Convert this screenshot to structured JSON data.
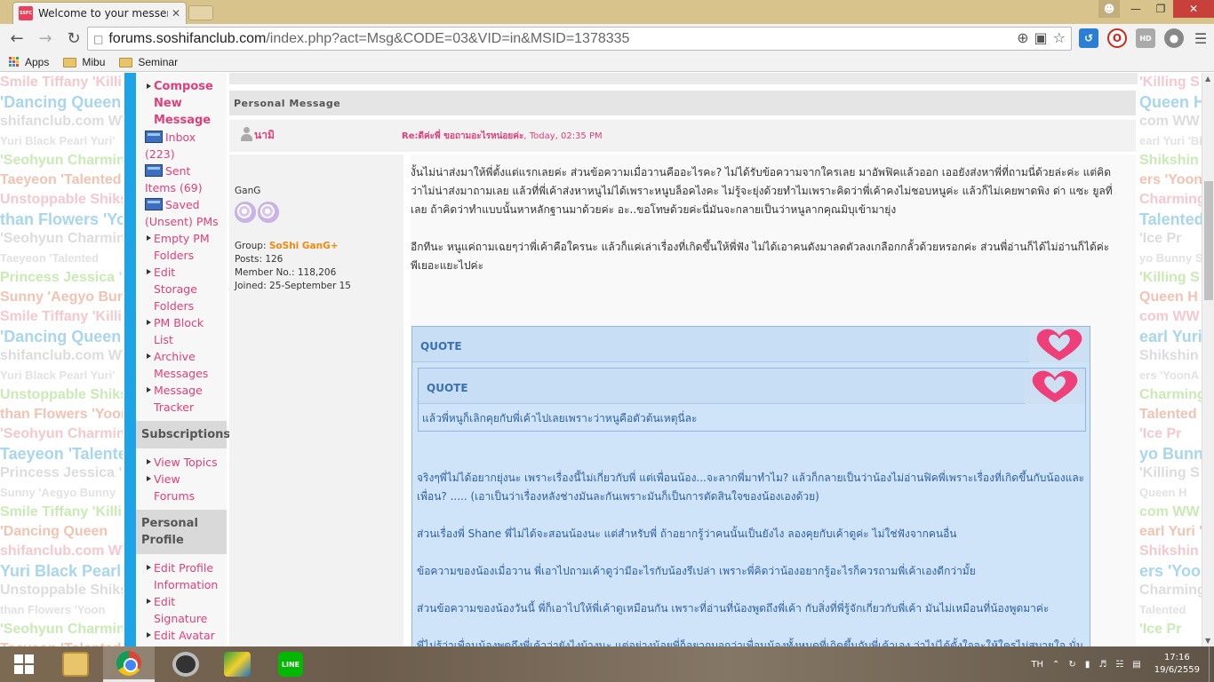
{
  "browser": {
    "tab_title": "Welcome to your messenc",
    "tab_favicon_text": "SSFC",
    "url": "forums.soshifanclub.com/index.php?act=Msg&CODE=03&VID=in&MSID=1378335",
    "url_host": "forums.soshifanclub.com",
    "url_path": "/index.php?act=Msg&CODE=03&VID=in&MSID=1378335",
    "bookmarks": [
      {
        "label": "Apps",
        "icon": "apps-grid-icon"
      },
      {
        "label": "Mibu",
        "icon": "folder-icon"
      },
      {
        "label": "Seminar",
        "icon": "folder-icon"
      }
    ]
  },
  "background_lines_left": [
    "Smile Tiffany 'Killing",
    "'Dancing Queen",
    "shifanclub.com WW",
    "Yuri Black Pearl Yuri'",
    "'Seohyun Charming",
    "Taeyeon 'Talented",
    "Unstoppable Shikshin",
    "than Flowers 'Yoon",
    "'Seohyun Charming",
    "Taeyeon 'Talented",
    "Princess Jessica 'Ice",
    "Sunny 'Aegyo Bunny",
    "Smile Tiffany 'Killing",
    "'Dancing Queen",
    "shifanclub.com WW",
    "Yuri Black Pearl Yuri'",
    "Unstoppable Shikshin",
    "than Flowers 'Yoon",
    "'Seohyun Charming",
    "Taeyeon 'Talented",
    "Princess Jessica 'Ice",
    "Sunny 'Aegyo Bunny",
    "Smile Tiffany 'Killing",
    "'Dancing Queen",
    "shifanclub.com WW",
    "Yuri Black Pearl Yuri'",
    "Unstoppable Shikshin",
    "than Flowers 'Yoon",
    "'Seohyun Charming",
    "Taeyeon 'Talented",
    "Princess Jessica 'Ice"
  ],
  "background_lines_right": [
    "'Killing S",
    "Queen H",
    "com WW",
    "earl Yuri 'Bl",
    "Shikshin 'Sh",
    "ers 'YoonA",
    "Charming",
    "Talented",
    "'Ice Pr",
    "yo Bunny Su",
    "'Killing S",
    "Queen H",
    "com WW",
    "earl Yuri 'Bl",
    "Shikshin 'Sh",
    "ers 'YoonA",
    "Charming",
    "Talented",
    "'Ice Pr",
    "yo Bunny Su",
    "'Killing S",
    "Queen H",
    "com WW",
    "earl Yuri 'Bl",
    "Shikshin 'Sh",
    "ers 'YoonA",
    "Charming",
    "Talented",
    "'Ice Pr"
  ],
  "sidebar": {
    "compose": "Compose New Message",
    "inbox": "Inbox (223)",
    "sent": "Sent Items (69)",
    "saved": "Saved (Unsent) PMs",
    "empty": "Empty PM Folders",
    "edit_storage": "Edit Storage Folders",
    "pm_block": "PM Block List",
    "archive": "Archive Messages",
    "tracker": "Message Tracker",
    "subscriptions_header": "Subscriptions",
    "view_topics": "View Topics",
    "view_forums": "View Forums",
    "profile_header": "Personal Profile",
    "edit_profile": "Edit Profile Information",
    "edit_signature": "Edit Signature",
    "edit_avatar": "Edit Avatar Settings"
  },
  "message": {
    "section_title": "Personal Message",
    "poster_name": "นามิ",
    "subject": "Re:ดีค่ะพี่ ขอถามอะไรหน่อยค่ะ",
    "date": ", Today, 02:35 PM",
    "user": {
      "title": "GanG",
      "group_label": "Group:",
      "group_name": "SoShi GanG+",
      "posts": "Posts: 126",
      "member_no": "Member No.: 118,206",
      "joined": "Joined: 25-September 15"
    },
    "body_p1": "งั้นไม่น่าส่งมาให้พี่ตั้งแต่แรกเลยค่ะ ส่วนข้อความเมื่อวานคืออะไรคะ? ไม่ได้รับข้อความจากใครเลย มาอัพฟิคแล้วออก เออยังส่งหาพี่ที่ถามนี่ด้วยล่ะค่ะ แต่คิดว่าไม่น่าส่งมาถามเลย แล้วที่พี่เค้าส่งหาหนูไม่ได้เพราะหนูบล็อคไงคะ ไม่รู้จะยุ่งด้วยทำไมเพราะคิดว่าพี่เค้าคงไม่ชอบหนูค่ะ แล้วก็ไม่เคยพาดพิง ด่า แซะ ยูลที่ เลย ถ้าคิดว่าทำแบบนั้นหาหลักฐานมาด้วยค่ะ อะ..ขอโทษด้วยค่ะนี่มันจะกลายเป็นว่าหนูลากคุณมิบุเข้ามายุ่ง",
    "body_p2": "อีกทีนะ หนูแค่ถามเฉยๆว่าพี่เค้าคือใครนะ แล้วก็แค่เล่าเรื่องที่เกิดขึ้นให้พี่ฟัง ไม่ได้เอาคนดังมาลดตัวลงเกลือกกลั้วด้วยหรอกค่ะ ส่วนพี่อ่านก็ได้ไม่อ่านก็ได้ค่ะ พีเยอะแยะไปค่ะ",
    "quote_label": "QUOTE",
    "inner_quote_label": "QUOTE",
    "inner_quote_text": "แล้วพี่หนูก็เลิกคุยกับพี่เค้าไปเลยเพราะว่าหนูคือตัวต้นเหตุนี่ละ",
    "quote_p1": "จริงๆพี่ไม่ได้อยากยุ่งนะ เพราะเรื่องนี้ไม่เกี่ยวกับพี่ แต่เพื่อนน้อง...จะลากพี่มาทำไม? แล้วก็กลายเป็นว่าน้องไม่อ่านฟิคพี่เพราะเรื่องที่เกิดขึ้นกับน้องและเพื่อน? ..... (เอาเป็นว่าเรื่องหลังช่างมันละกันเพราะมันก็เป็นการตัดสินใจของน้องเองด้วย)",
    "quote_p2": "ส่วนเรื่องพี่ Shane พี่ไม่ได้จะสอนน้องนะ แต่สำหรับพี่ ถ้าอยากรู้ว่าคนนั้นเป็นยังไง ลองคุยกับเค้าดูค่ะ ไม่ใช่ฟังจากคนอื่น",
    "quote_p3": "ข้อความของน้องเมื่อวาน พี่เอาไปถามเค้าดูว่ามีอะไรกับน้องรึเปล่า เพราะพี่คิดว่าน้องอยากรู้อะไรก็ควรถามพี่เค้าเองดีกว่ามั้ย",
    "quote_p4": "ส่วนข้อความของน้องวันนี้ พี่ก็เอาไปให้พี่เค้าดูเหมือนกัน เพราะที่อ่านที่น้องพูดถึงพี่เค้า กับสิ่งที่พี่รู้จักเกี่ยวกับพี่เค้า มันไม่เหมือนที่น้องพูดมาค่ะ",
    "quote_p5": "พี่ไม่รู้ว่าเพื่อนน้องพูดถึงพี่เค้าว่ายังไงบ้างนะ แต่อย่างน้อยพี่ก็อยากบอกว่าเพื่อนน้องทั้งหมดที่เกิดขึ้นกับพี่เค้าเอง ว่าไม่ได้ตั้งใจจะให้ใครไม่สบายใจ นั่นก็คือที่พี่อยากบอก"
  },
  "taskbar": {
    "apps": [
      "file-explorer-icon",
      "chrome-icon",
      "app-icon",
      "media-icon",
      "line-icon"
    ],
    "line_label": "LINE",
    "language": "TH",
    "time": "17:16",
    "date": "19/6/2559"
  }
}
